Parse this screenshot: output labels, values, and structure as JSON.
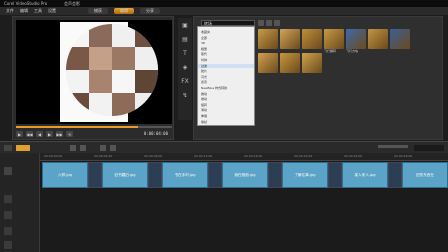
{
  "window": {
    "title": "Corel VideoStudio Pro",
    "title_extra": "会声会影"
  },
  "menu": {
    "items": [
      "文件",
      "编辑",
      "工具",
      "设置"
    ],
    "steps": [
      "捕获",
      "编辑",
      "分享"
    ],
    "active_step": 1
  },
  "player": {
    "timecode": "0:00:04:00",
    "progress": 0.78,
    "buttons": [
      "▶",
      "◀◀",
      "◀",
      "▶",
      "▶▶",
      "⟲"
    ]
  },
  "library": {
    "category": "转场",
    "dropdown": [
      "收藏夹",
      "全部",
      "3D",
      "相册",
      "取代",
      "时钟",
      "过滤",
      "胶片",
      "闪光",
      "遮罩",
      "NewBlue 样式转换",
      "推动",
      "卷动",
      "旋转",
      "滑动",
      "伸展",
      "擦拭"
    ],
    "selected": "过滤",
    "thumbs": [
      {
        "label": "",
        "color": "#c89b45"
      },
      {
        "label": "",
        "color": "#d1a45a"
      },
      {
        "label": "",
        "color": "#bf8e3b"
      },
      {
        "label": "飞行翻转",
        "color": "#c79a43"
      },
      {
        "label": "飞行方块",
        "color": "#3d6aa8"
      },
      {
        "label": "",
        "color": "#c49442"
      },
      {
        "label": "",
        "color": "#3b5f9a"
      },
      {
        "label": "",
        "color": "#d2a14f"
      },
      {
        "label": "",
        "color": "#c8983e"
      },
      {
        "label": "",
        "color": "#cfa24c"
      }
    ]
  },
  "timeline": {
    "ruler": [
      "00:00:00:00",
      "00:00:04:00",
      "00:00:08:00",
      "00:00:12:00",
      "00:00:16:00",
      "00:00:20:00",
      "00:00:24:00",
      "00:00:28:00"
    ],
    "clips": [
      "六样.jpg",
      "旧书翻旧.jpg",
      "书在手时.jpg",
      "她在相册.jpg",
      "了解往事.jpg",
      "某人来人.jpg",
      "旧的东西在"
    ]
  }
}
